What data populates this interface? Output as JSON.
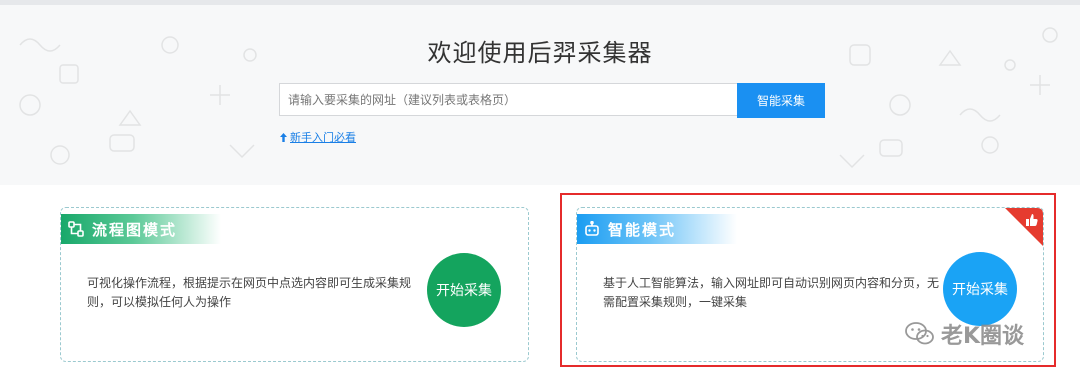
{
  "hero": {
    "title": "欢迎使用后羿采集器",
    "search": {
      "placeholder": "请输入要采集的网址（建议列表或表格页）",
      "value": "",
      "button_label": "智能采集"
    },
    "newbie_link": "新手入门必看"
  },
  "cards": [
    {
      "title": "流程图模式",
      "description": "可视化操作流程，根据提示在网页中点选内容即可生成采集规则，可以模拟任何人为操作",
      "button_label": "开始采集",
      "accent": "#14a45e",
      "icon": "flowchart-icon"
    },
    {
      "title": "智能模式",
      "description": "基于人工智能算法，输入网址即可自动识别网页内容和分页，无需配置采集规则，一键采集",
      "button_label": "开始采集",
      "accent": "#1aa3f5",
      "icon": "robot-icon",
      "badge_icon": "thumbs-up-icon",
      "highlighted": true
    }
  ],
  "watermark": {
    "text": "老K圈谈",
    "icon": "wechat-icon"
  },
  "colors": {
    "primary": "#1a90f2",
    "highlight_border": "#e52b2b",
    "badge": "#e53b2f"
  }
}
